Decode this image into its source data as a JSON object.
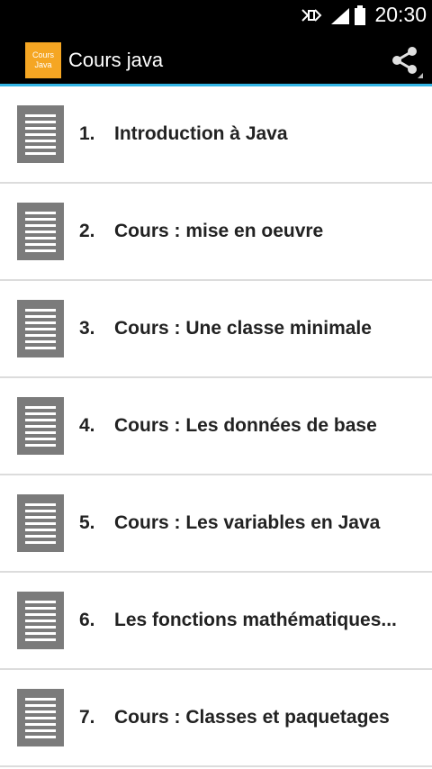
{
  "status_bar": {
    "time": "20:30",
    "icons": [
      "nfc-icon",
      "signal-icon",
      "battery-icon"
    ]
  },
  "action_bar": {
    "logo_line1": "Cours",
    "logo_line2": "Java",
    "title": "Cours java",
    "share_icon": "share-icon"
  },
  "colors": {
    "accent": "#33b5e5",
    "logo": "#f5a623",
    "doc_icon": "#7b7b7b"
  },
  "items": [
    {
      "number": "1.",
      "label": "Introduction à Java"
    },
    {
      "number": "2.",
      "label": "Cours : mise en oeuvre"
    },
    {
      "number": "3.",
      "label": "Cours : Une classe minimale"
    },
    {
      "number": "4.",
      "label": "Cours : Les données de base"
    },
    {
      "number": "5.",
      "label": "Cours : Les variables en Java"
    },
    {
      "number": "6.",
      "label": "Les fonctions mathématiques..."
    },
    {
      "number": "7.",
      "label": "Cours : Classes et paquetages"
    }
  ]
}
